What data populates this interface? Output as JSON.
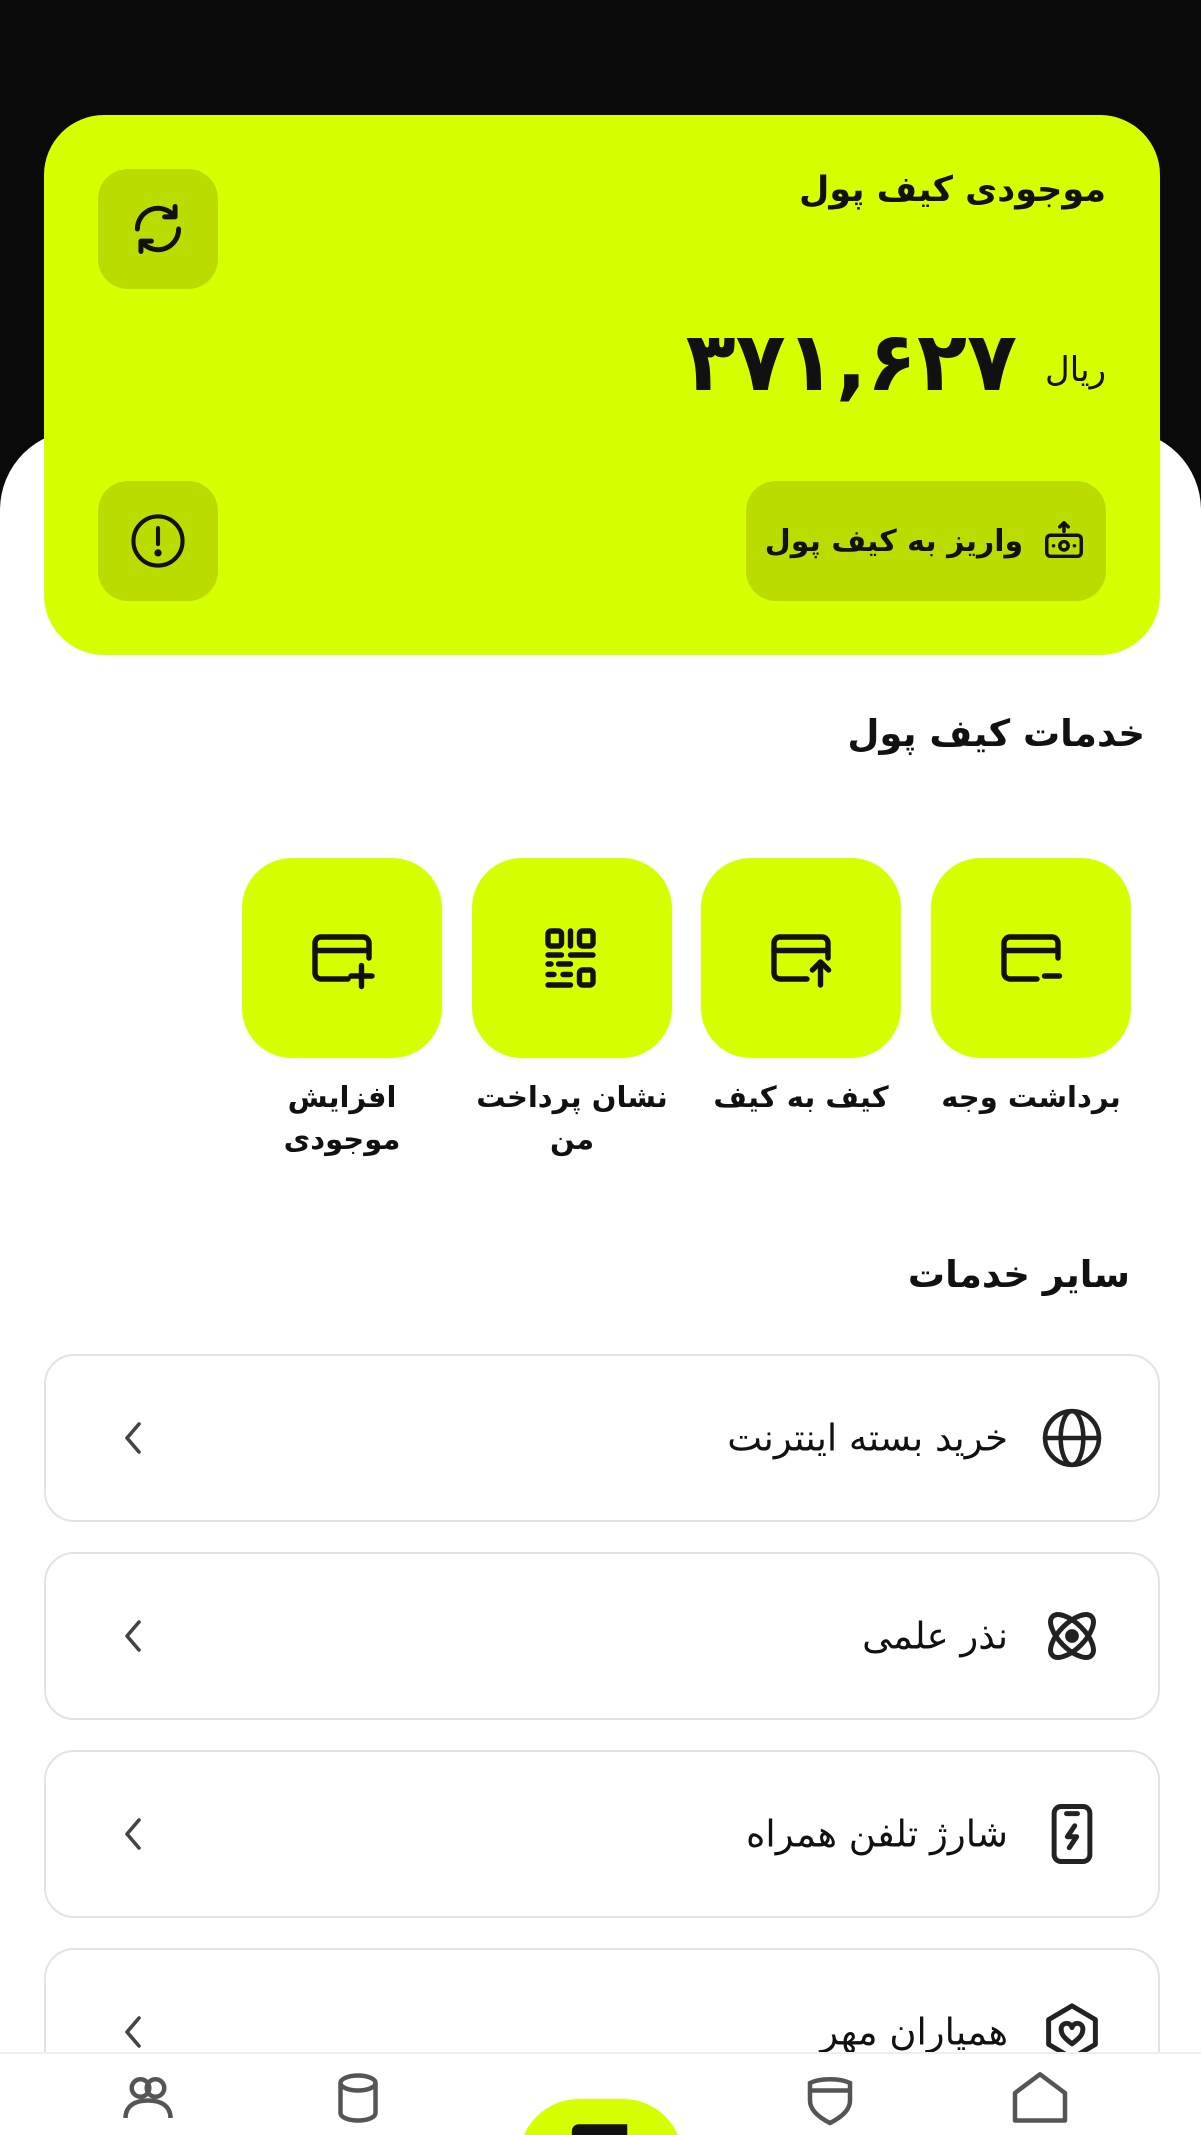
{
  "wallet": {
    "title": "موجودی کیف پول",
    "balance": "۳۷۱,۶۲۷",
    "currency": "ریال",
    "deposit_label": "واریز به کیف پول",
    "accent_color": "#d6ff00",
    "accent_dark": "#bcdc00"
  },
  "wallet_services": {
    "title": "خدمات کیف پول",
    "items": [
      {
        "label": "برداشت وجه",
        "icon": "card-minus-icon"
      },
      {
        "label": "کیف به کیف",
        "icon": "card-upload-icon"
      },
      {
        "label": "نشان پرداخت من",
        "icon": "qr-code-icon"
      },
      {
        "label": "افزایش موجودی",
        "icon": "card-plus-icon"
      }
    ]
  },
  "other_services": {
    "title": "سایر خدمات",
    "items": [
      {
        "label": "خرید بسته اینترنت",
        "icon": "globe-icon"
      },
      {
        "label": "نذر علمی",
        "icon": "atom-icon"
      },
      {
        "label": "شارژ تلفن همراه",
        "icon": "phone-charge-icon"
      },
      {
        "label": "همیاران مهر",
        "icon": "heart-shield-icon"
      }
    ]
  }
}
